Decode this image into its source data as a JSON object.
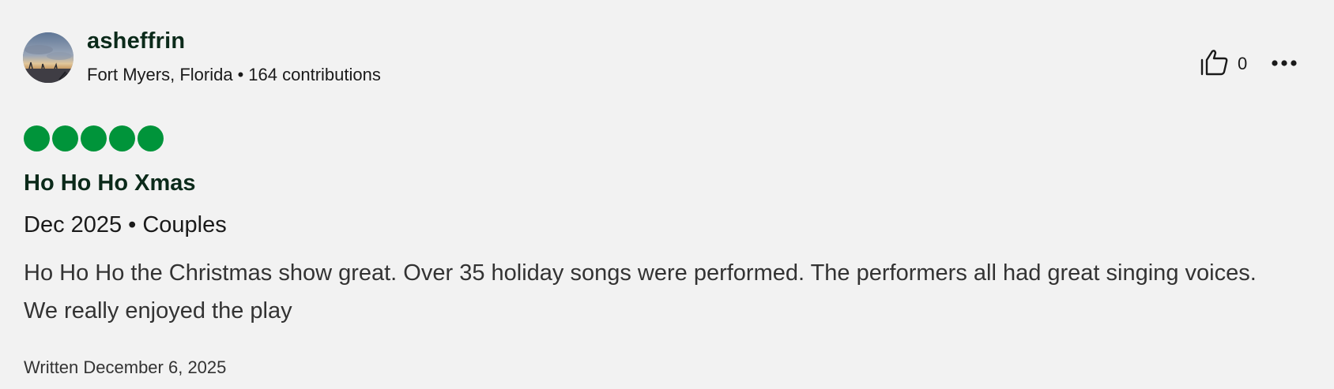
{
  "user": {
    "name": "asheffrin",
    "location": "Fort Myers, Florida",
    "separator": "•",
    "contributions": "164 contributions"
  },
  "actions": {
    "helpful_icon": "thumbs-up-icon",
    "helpful_count": "0",
    "more_icon": "more-horizontal-icon"
  },
  "review": {
    "rating": 5,
    "rating_max": 5,
    "rating_color": "#00943a",
    "title": "Ho Ho Ho Xmas",
    "date": "Dec 2025",
    "separator": "•",
    "trip_type": "Couples",
    "body": "Ho Ho Ho the Christmas show great. Over 35 holiday songs were performed. The performers all had great singing voices. We really enjoyed the play",
    "written": "Written December 6, 2025"
  },
  "colors": {
    "background": "#f2f2f2",
    "title_text": "#0b2a1a",
    "body_text": "#333333"
  }
}
